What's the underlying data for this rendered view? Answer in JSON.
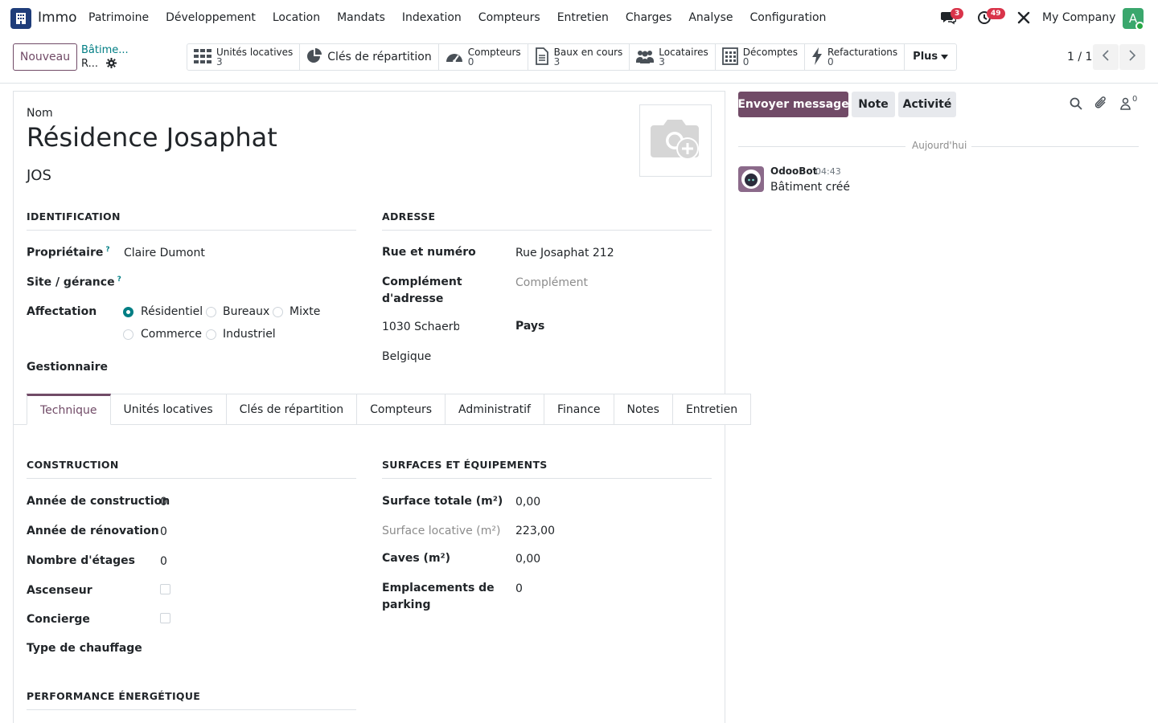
{
  "navbar": {
    "app_name": "Immo",
    "menu": [
      "Patrimoine",
      "Développement",
      "Location",
      "Mandats",
      "Indexation",
      "Compteurs",
      "Entretien",
      "Charges",
      "Analyse",
      "Configuration"
    ],
    "messages_badge": "3",
    "activities_badge": "49",
    "company": "My Company",
    "avatar_letter": "A"
  },
  "control": {
    "new_button": "Nouveau",
    "breadcrumb_parent": "Bâtime...",
    "breadcrumb_current": "R...",
    "smart_buttons": [
      {
        "label": "Unités locatives",
        "count": "3",
        "icon": "grid-icon"
      },
      {
        "label": "Clés de répartition",
        "count": "",
        "icon": "pie-chart-icon"
      },
      {
        "label": "Compteurs",
        "count": "0",
        "icon": "gauge-icon"
      },
      {
        "label": "Baux en cours",
        "count": "3",
        "icon": "document-icon"
      },
      {
        "label": "Locataires",
        "count": "3",
        "icon": "users-icon"
      },
      {
        "label": "Décomptes",
        "count": "0",
        "icon": "calculator-icon"
      },
      {
        "label": "Refacturations",
        "count": "0",
        "icon": "bolt-icon"
      }
    ],
    "more_label": "Plus",
    "pager": "1 / 1"
  },
  "form": {
    "name_label": "Nom",
    "name": "Résidence Josaphat",
    "code": "JOS",
    "identification": {
      "title": "IDENTIFICATION",
      "owner_label": "Propriétaire",
      "owner_value": "Claire Dumont",
      "site_label": "Site / gérance",
      "affectation_label": "Affectation",
      "affectation_options": [
        "Résidentiel",
        "Bureaux",
        "Mixte",
        "Commerce",
        "Industriel"
      ],
      "affectation_selected": "Résidentiel",
      "manager_label": "Gestionnaire",
      "help_mark": "?"
    },
    "address": {
      "title": "ADRESSE",
      "street_label": "Rue et numéro",
      "street_value": "Rue Josaphat 212",
      "complement_label_1": "Complément",
      "complement_label_2": "d'adresse",
      "complement_placeholder": "Complément",
      "city_value": "1030 Schaerbe",
      "country_label": "Pays",
      "country_value": "Belgique"
    },
    "tabs": [
      "Technique",
      "Unités locatives",
      "Clés de répartition",
      "Compteurs",
      "Administratif",
      "Finance",
      "Notes",
      "Entretien"
    ],
    "active_tab": "Technique",
    "construction": {
      "title": "CONSTRUCTION",
      "year_built_label": "Année de construction",
      "year_built": "0",
      "year_renov_label": "Année de rénovation",
      "year_renov": "0",
      "floors_label": "Nombre d'étages",
      "floors": "0",
      "elevator_label": "Ascenseur",
      "concierge_label": "Concierge",
      "heating_label": "Type de chauffage"
    },
    "surfaces": {
      "title": "SURFACES ET ÉQUIPEMENTS",
      "total_label": "Surface totale (m²)",
      "total_value": "0,00",
      "rental_label": "Surface locative (m²)",
      "rental_value": "223,00",
      "cellars_label": "Caves (m²)",
      "cellars_value": "0,00",
      "parking_label_1": "Emplacements de",
      "parking_label_2": "parking",
      "parking_value": "0"
    },
    "energy_title": "PERFORMANCE ÉNERGÉTIQUE"
  },
  "chatter": {
    "send_message": "Envoyer message",
    "note": "Note",
    "activity": "Activité",
    "followers_count": "0",
    "day_separator": "Aujourd'hui",
    "messages": [
      {
        "author": "OdooBot",
        "time": "04:43",
        "body": "Bâtiment créé"
      }
    ]
  }
}
